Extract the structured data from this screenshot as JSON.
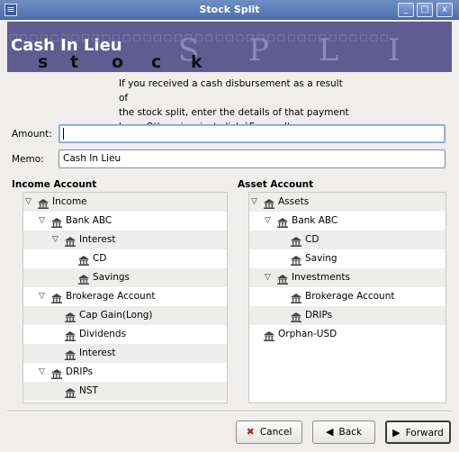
{
  "window": {
    "title": "Stock Split",
    "controls": [
      "_",
      "□",
      "x"
    ]
  },
  "banner": {
    "page_title": "Cash In Lieu",
    "watermark": "S P L I T",
    "logo_letters": [
      "s",
      "t",
      "o",
      "c",
      "k"
    ]
  },
  "info": {
    "lines": [
      "If you received a cash disbursement as a result of",
      "the stock split, enter the details of that payment",
      "here. Otherwise, just click `Forward'."
    ]
  },
  "form": {
    "amount_label": "Amount:",
    "amount_value": "",
    "memo_label": "Memo:",
    "memo_value": "Cash In Lieu"
  },
  "income_account": {
    "label": "Income Account",
    "rows": [
      {
        "label": "Income",
        "level": 0,
        "expander": "open"
      },
      {
        "label": "Bank ABC",
        "level": 1,
        "expander": "open"
      },
      {
        "label": "Interest",
        "level": 2,
        "expander": "open"
      },
      {
        "label": "CD",
        "level": 3,
        "expander": "none"
      },
      {
        "label": "Savings",
        "level": 3,
        "expander": "none"
      },
      {
        "label": "Brokerage Account",
        "level": 1,
        "expander": "open"
      },
      {
        "label": "Cap Gain(Long)",
        "level": 2,
        "expander": "none"
      },
      {
        "label": "Dividends",
        "level": 2,
        "expander": "none"
      },
      {
        "label": "Interest",
        "level": 2,
        "expander": "none"
      },
      {
        "label": "DRIPs",
        "level": 1,
        "expander": "open"
      },
      {
        "label": "NST",
        "level": 2,
        "expander": "none"
      }
    ]
  },
  "asset_account": {
    "label": "Asset Account",
    "rows": [
      {
        "label": "Assets",
        "level": 0,
        "expander": "open"
      },
      {
        "label": "Bank ABC",
        "level": 1,
        "expander": "open"
      },
      {
        "label": "CD",
        "level": 2,
        "expander": "none"
      },
      {
        "label": "Saving",
        "level": 2,
        "expander": "none"
      },
      {
        "label": "Investments",
        "level": 1,
        "expander": "open"
      },
      {
        "label": "Brokerage Account",
        "level": 2,
        "expander": "none"
      },
      {
        "label": "DRIPs",
        "level": 2,
        "expander": "none"
      },
      {
        "label": "Orphan-USD",
        "level": 0,
        "expander": "none"
      }
    ]
  },
  "buttons": {
    "cancel": "Cancel",
    "back": "Back",
    "forward": "Forward"
  },
  "colors": {
    "banner": "#605c92",
    "titlebar": "#4d6fae"
  }
}
